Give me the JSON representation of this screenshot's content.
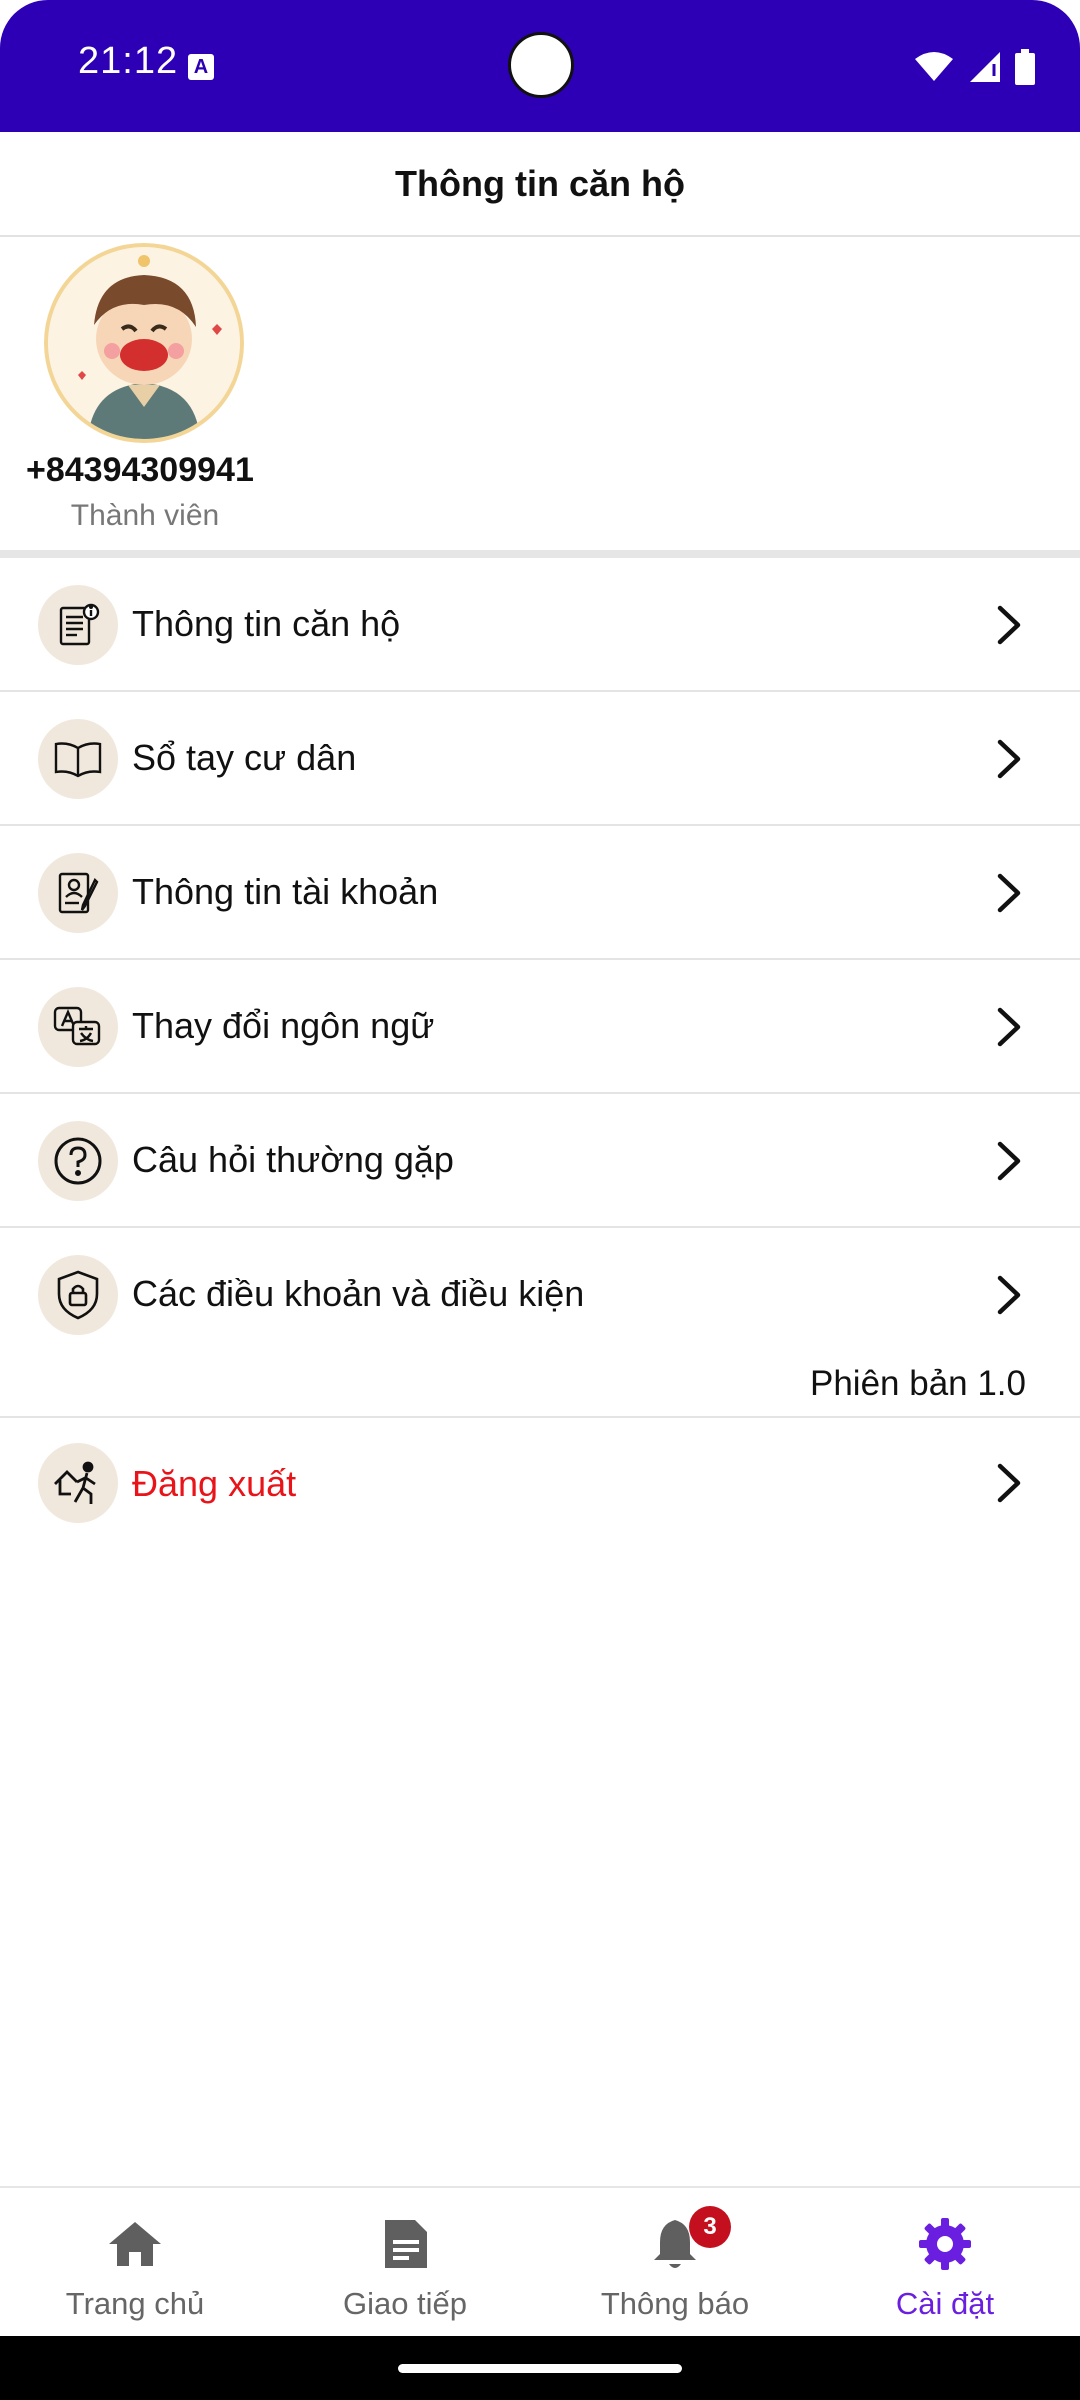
{
  "status_bar": {
    "time": "21:12",
    "notif_icon_letter": "A"
  },
  "header": {
    "title": "Thông tin căn hộ"
  },
  "profile": {
    "phone": "+84394309941",
    "role": "Thành viên"
  },
  "menu": {
    "items": [
      {
        "label": "Thông tin căn hộ",
        "icon": "document-info-icon"
      },
      {
        "label": "Sổ tay cư dân",
        "icon": "open-book-icon"
      },
      {
        "label": "Thông tin tài khoản",
        "icon": "account-edit-icon"
      },
      {
        "label": "Thay đổi ngôn ngữ",
        "icon": "translate-icon"
      },
      {
        "label": "Câu hỏi thường gặp",
        "icon": "question-icon"
      },
      {
        "label": "Các điều khoản và điều kiện",
        "icon": "shield-lock-icon"
      }
    ],
    "version": "Phiên bản 1.0",
    "logout_label": "Đăng xuất"
  },
  "bottom_nav": {
    "items": [
      {
        "label": "Trang chủ",
        "icon": "home-icon",
        "active": false
      },
      {
        "label": "Giao tiếp",
        "icon": "document-icon",
        "active": false
      },
      {
        "label": "Thông báo",
        "icon": "bell-icon",
        "active": false,
        "badge": "3"
      },
      {
        "label": "Cài đặt",
        "icon": "gear-icon",
        "active": true
      }
    ]
  },
  "colors": {
    "status_bar": "#2d00b5",
    "accent": "#6a1fe0",
    "logout": "#e8141a",
    "badge": "#c4101e",
    "icon_bg": "#f0e8dc"
  }
}
